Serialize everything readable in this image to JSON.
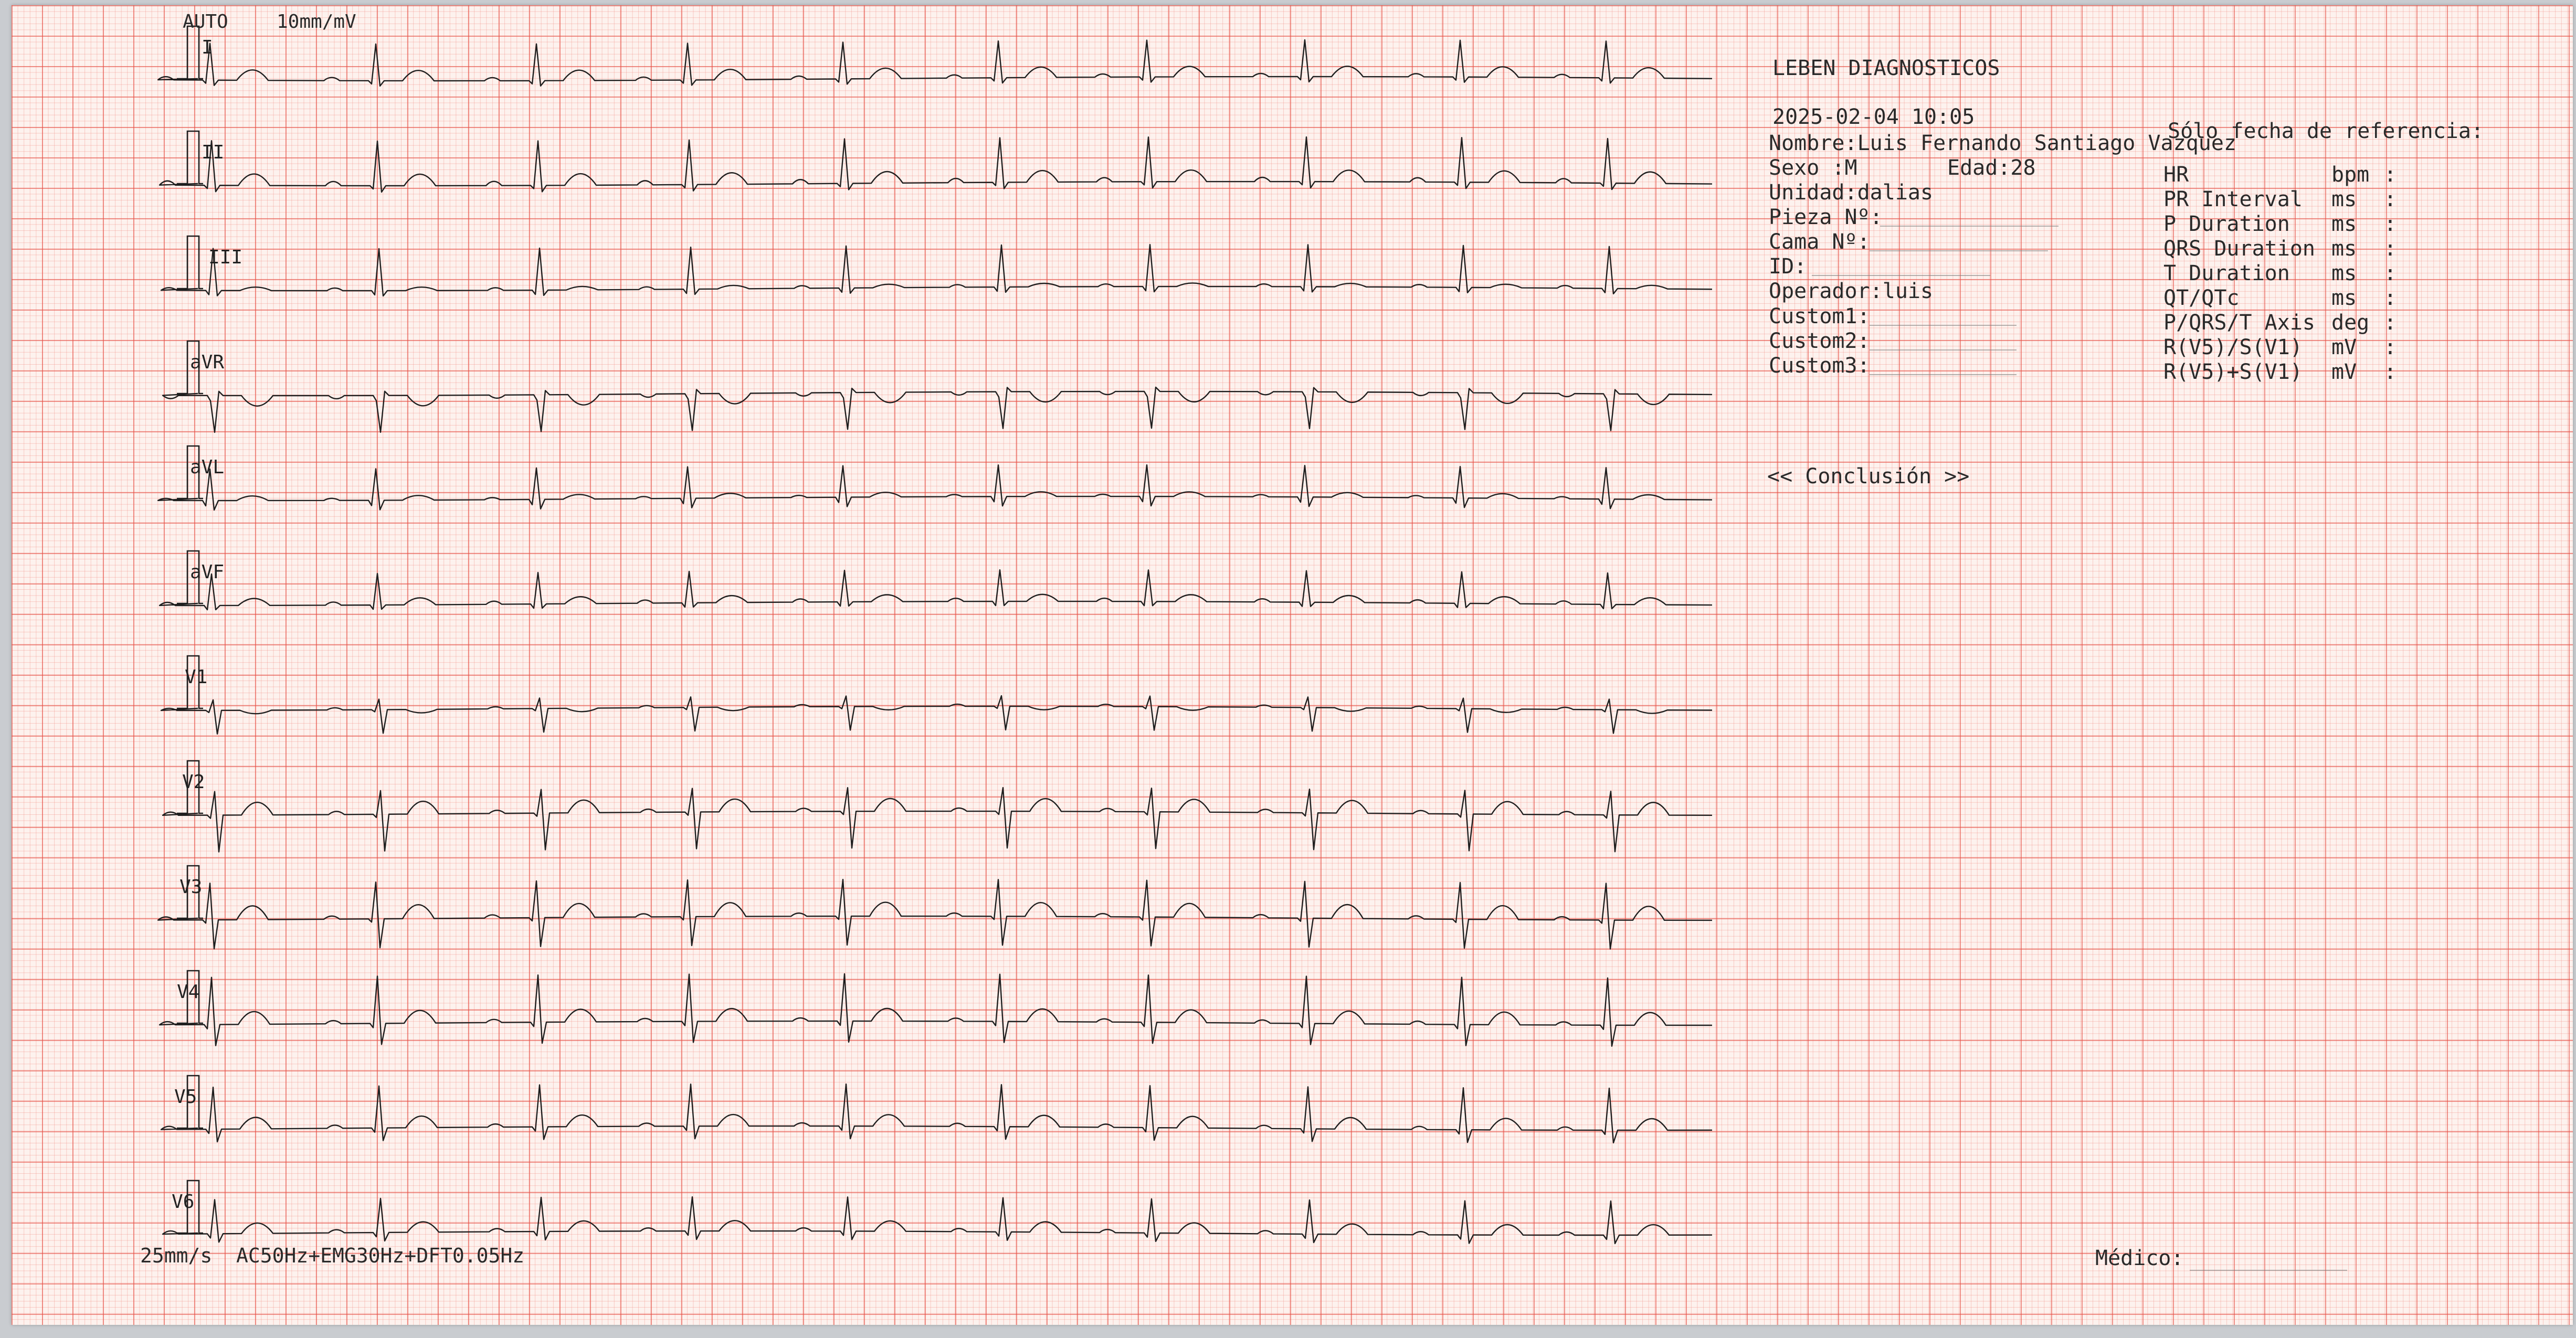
{
  "header": {
    "mode": "AUTO",
    "gain": "10mm/mV"
  },
  "leads": [
    "I",
    "II",
    "III",
    "aVR",
    "aVL",
    "aVF",
    "V1",
    "V2",
    "V3",
    "V4",
    "V5",
    "V6"
  ],
  "footer": {
    "settings_text": "25mm/s  AC50Hz+EMG30Hz+DFT0.05Hz",
    "medico_label": "Médico:"
  },
  "patient": {
    "institution": "LEBEN DIAGNOSTICOS",
    "datetime": "2025-02-04 10:05",
    "name": "Nombre:Luis Fernando Santiago Vazquez",
    "sex": "Sexo :M",
    "age": "Edad:28",
    "unit": "Unidad:dalias",
    "pieza": "Pieza Nº:",
    "cama": "Cama Nº:",
    "id": "ID:",
    "operador": "Operador:luis",
    "custom1": "Custom1:",
    "custom2": "Custom2:",
    "custom3": "Custom3:"
  },
  "measurements": {
    "reference_note": "Sólo fecha de referencia:",
    "rows": [
      {
        "label": "HR",
        "unit": "bpm"
      },
      {
        "label": "PR Interval",
        "unit": "ms"
      },
      {
        "label": "P Duration",
        "unit": "ms"
      },
      {
        "label": "QRS Duration",
        "unit": "ms"
      },
      {
        "label": "T Duration",
        "unit": "ms"
      },
      {
        "label": "QT/QTc",
        "unit": "ms"
      },
      {
        "label": "P/QRS/T Axis",
        "unit": "deg"
      },
      {
        "label": "R(V5)/S(V1)",
        "unit": "mV"
      },
      {
        "label": "R(V5)+S(V1)",
        "unit": "mV"
      }
    ]
  },
  "conclusion_label": "<< Conclusión >>",
  "colors": {
    "grid_major": "#e65046",
    "grid_minor": "#f08278",
    "paper": "#fdf2ee",
    "trace": "#1e1e1e"
  }
}
